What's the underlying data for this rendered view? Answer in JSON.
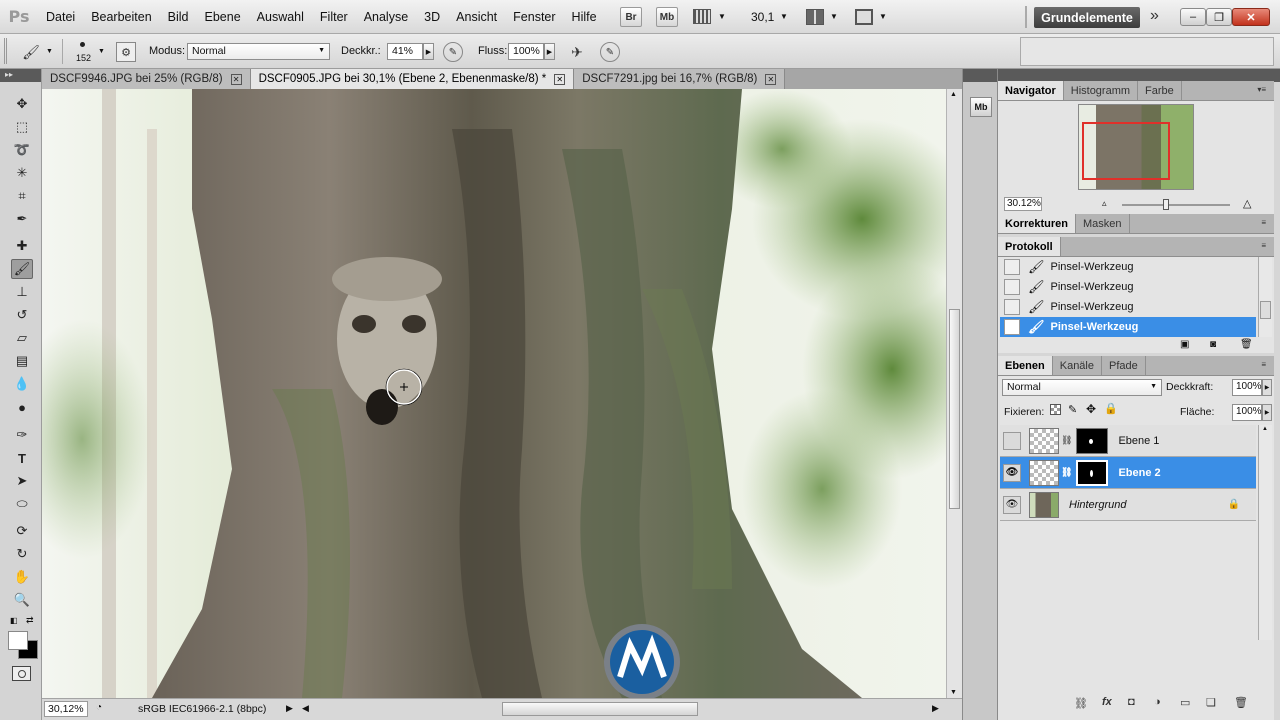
{
  "app": {
    "logo": "Ps",
    "menu": [
      "Datei",
      "Bearbeiten",
      "Bild",
      "Ebene",
      "Auswahl",
      "Filter",
      "Analyse",
      "3D",
      "Ansicht",
      "Fenster",
      "Hilfe"
    ],
    "bridge_btn": "Br",
    "minibridge_btn": "Mb",
    "zoom_value": "30,1",
    "workspace": "Grundelemente"
  },
  "options": {
    "brush_size": "152",
    "mode_label": "Modus:",
    "mode_value": "Normal",
    "opacity_label": "Deckkr.:",
    "opacity_value": "41%",
    "flow_label": "Fluss:",
    "flow_value": "100%"
  },
  "tabs": [
    {
      "label": "DSCF9946.JPG bei 25% (RGB/8)"
    },
    {
      "label": "DSCF0905.JPG bei 30,1% (Ebene 2, Ebenenmaske/8) *"
    },
    {
      "label": "DSCF7291.jpg bei 16,7% (RGB/8)"
    }
  ],
  "status": {
    "zoom": "30,12%",
    "profile": "sRGB IEC61966-2.1 (8bpc)"
  },
  "navigator": {
    "tabs": [
      "Navigator",
      "Histogramm",
      "Farbe"
    ],
    "zoom": "30.12%"
  },
  "adjust_tabs": [
    "Korrekturen",
    "Masken"
  ],
  "history": {
    "title": "Protokoll",
    "items": [
      "Pinsel-Werkzeug",
      "Pinsel-Werkzeug",
      "Pinsel-Werkzeug",
      "Pinsel-Werkzeug"
    ]
  },
  "layers": {
    "tabs": [
      "Ebenen",
      "Kanäle",
      "Pfade"
    ],
    "blend_mode": "Normal",
    "opacity_label": "Deckkraft:",
    "opacity_value": "100%",
    "lock_label": "Fixieren:",
    "fill_label": "Fläche:",
    "fill_value": "100%",
    "items": [
      {
        "name": "Ebene 1"
      },
      {
        "name": "Ebene 2"
      },
      {
        "name": "Hintergrund"
      }
    ]
  }
}
